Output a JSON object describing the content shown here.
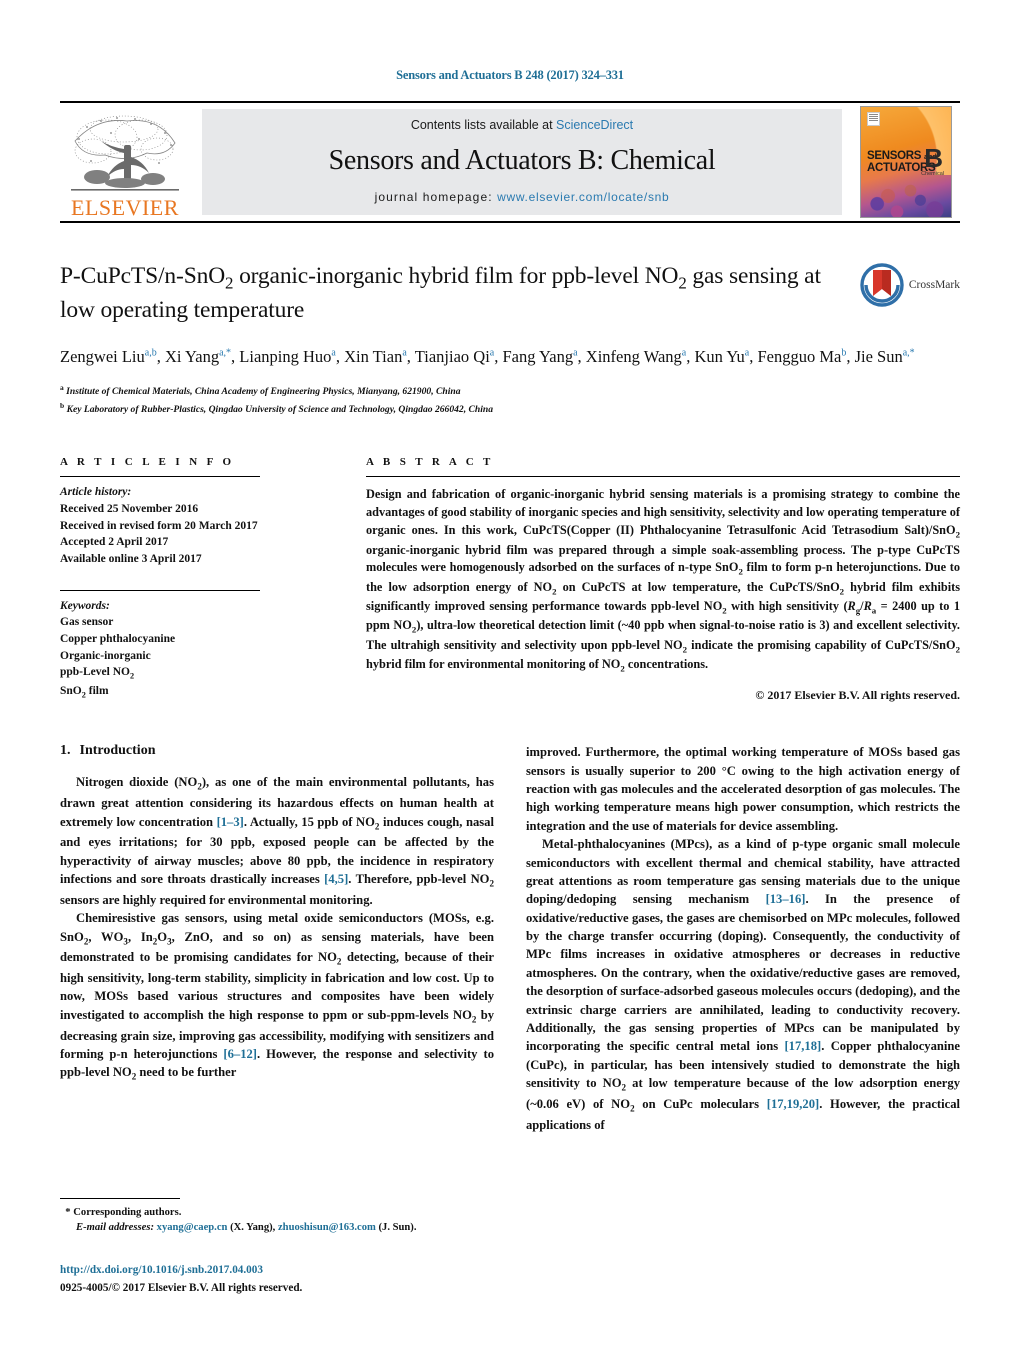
{
  "running_head": "Sensors and Actuators B 248 (2017) 324–331",
  "masthead": {
    "publisher_name": "ELSEVIER",
    "contents_prefix": "Contents lists available at ",
    "contents_link": "ScienceDirect",
    "journal_title": "Sensors and Actuators B: Chemical",
    "homepage_label": "journal homepage:",
    "homepage_url": "www.elsevier.com/locate/snb",
    "cover": {
      "line1": "SENSORS",
      "line1_small": "and",
      "line2": "ACTUATORS",
      "letter": "B",
      "sub": "Chemical"
    }
  },
  "article": {
    "title_line1": "P-CuPcTS/n-SnO2 organic-inorganic hybrid film for ppb-level NO2 gas",
    "title_line2": "sensing at low operating temperature",
    "crossmark_label": "CrossMark",
    "authors": [
      {
        "name": "Zengwei Liu",
        "marks": "a,b",
        "sep": ", "
      },
      {
        "name": "Xi Yang",
        "marks": "a,*",
        "sep": ", "
      },
      {
        "name": "Lianping Huo",
        "marks": "a",
        "sep": ", "
      },
      {
        "name": "Xin Tian",
        "marks": "a",
        "sep": ", "
      },
      {
        "name": "Tianjiao Qi",
        "marks": "a",
        "sep": ", "
      },
      {
        "name": "Fang Yang",
        "marks": "a",
        "sep": ", "
      },
      {
        "name": "Xinfeng Wang",
        "marks": "a",
        "sep": ", "
      },
      {
        "name": "Kun Yu",
        "marks": "a",
        "sep": ", "
      },
      {
        "name": "Fengguo Ma",
        "marks": "b",
        "sep": ", "
      },
      {
        "name": "Jie Sun",
        "marks": "a,*",
        "sep": ""
      }
    ],
    "affiliations": [
      {
        "mark": "a",
        "text": "Institute of Chemical Materials, China Academy of Engineering Physics, Mianyang, 621900, China"
      },
      {
        "mark": "b",
        "text": "Key Laboratory of Rubber-Plastics, Qingdao University of Science and Technology, Qingdao 266042, China"
      }
    ]
  },
  "article_info": {
    "heading": "A R T I C L E    I N F O",
    "history_label": "Article history:",
    "history": [
      "Received 25 November 2016",
      "Received in revised form 20 March 2017",
      "Accepted 2 April 2017",
      "Available online 3 April 2017"
    ],
    "keywords_label": "Keywords:",
    "keywords": [
      "Gas sensor",
      "Copper phthalocyanine",
      "Organic-inorganic",
      "ppb-Level NO2",
      "SnO2 film"
    ]
  },
  "abstract": {
    "heading": "A B S T R A C T",
    "text": "Design and fabrication of organic-inorganic hybrid sensing materials is a promising strategy to combine the advantages of good stability of inorganic species and high sensitivity, selectivity and low operating temperature of organic ones. In this work, CuPcTS(Copper (II) Phthalocyanine Tetrasulfonic Acid Tetrasodium Salt)/SnO2 organic-inorganic hybrid film was prepared through a simple soak-assembling process. The p-type CuPcTS molecules were homogenously adsorbed on the surfaces of n-type SnO2 film to form p-n heterojunctions. Due to the low adsorption energy of NO2 on CuPcTS at low temperature, the CuPcTS/SnO2 hybrid film exhibits significantly improved sensing performance towards ppb-level NO2 with high sensitivity (Rg/Ra = 2400 up to 1 ppm NO2), ultra-low theoretical detection limit (~40 ppb when signal-to-noise ratio is 3) and excellent selectivity. The ultrahigh sensitivity and selectivity upon ppb-level NO2 indicate the promising capability of CuPcTS/SnO2 hybrid film for environmental monitoring of NO2 concentrations.",
    "copyright": "© 2017 Elsevier B.V. All rights reserved."
  },
  "introduction": {
    "number": "1.",
    "title": "Introduction",
    "paragraphs_left": [
      "Nitrogen dioxide (NO2), as one of the main environmental pollutants, has drawn great attention considering its hazardous effects on human health at extremely low concentration [1–3]. Actually, 15 ppb of NO2 induces cough, nasal and eyes irritations; for 30 ppb, exposed people can be affected by the hyperactivity of airway muscles; above 80 ppb, the incidence in respiratory infections and sore throats drastically increases [4,5]. Therefore, ppb-level NO2 sensors are highly required for environmental monitoring.",
      "Chemiresistive gas sensors, using metal oxide semiconductors (MOSs, e.g. SnO2, WO3, In2O3, ZnO, and so on) as sensing materials, have been demonstrated to be promising candidates for NO2 detecting, because of their high sensitivity, long-term stability, simplicity in fabrication and low cost. Up to now, MOSs based various structures and composites have been widely investigated to accomplish the high response to ppm or sub-ppm-levels NO2 by decreasing grain size, improving gas accessibility, modifying with sensitizers and forming p-n heterojunctions [6–12]. However, the response and selectivity to ppb-level NO2 need to be further"
    ],
    "paragraphs_right": [
      "improved. Furthermore, the optimal working temperature of MOSs based gas sensors is usually superior to 200 °C owing to the high activation energy of reaction with gas molecules and the accelerated desorption of gas molecules. The high working temperature means high power consumption, which restricts the integration and the use of materials for device assembling.",
      "Metal-phthalocyanines (MPcs), as a kind of p-type organic small molecule semiconductors with excellent thermal and chemical stability, have attracted great attentions as room temperature gas sensing materials due to the unique doping/dedoping sensing mechanism [13–16]. In the presence of oxidative/reductive gases, the gases are chemisorbed on MPc molecules, followed by the charge transfer occurring (doping). Consequently, the conductivity of MPc films increases in oxidative atmospheres or decreases in reductive atmospheres. On the contrary, when the oxidative/reductive gases are removed, the desorption of surface-adsorbed gaseous molecules occurs (dedoping), and the extrinsic charge carriers are annihilated, leading to conductivity recovery. Additionally, the gas sensing properties of MPcs can be manipulated by incorporating the specific central metal ions [17,18]. Copper phthalocyanine (CuPc), in particular, has been intensively studied to demonstrate the high sensitivity to NO2 at low temperature because of the low adsorption energy (~0.06 eV) of NO2 on CuPc moleculars [17,19,20]. However, the practical applications of"
    ]
  },
  "footer": {
    "corresponding_mark": "*",
    "corresponding_label": "Corresponding authors.",
    "email_label": "E-mail addresses:",
    "email1": "xyang@caep.cn",
    "email1_who": "(X. Yang),",
    "email2": "zhuoshisun@163.com",
    "email2_who": "(J. Sun).",
    "doi": "http://dx.doi.org/10.1016/j.snb.2017.04.003",
    "issn": "0925-4005/© 2017 Elsevier B.V. All rights reserved."
  },
  "colors": {
    "link": "#1f6f96",
    "sciencedirect": "#2a7ab0",
    "elsevier_orange": "#E87722",
    "masthead_bg": "#e7e8ea",
    "reference": "#1f6f96"
  }
}
